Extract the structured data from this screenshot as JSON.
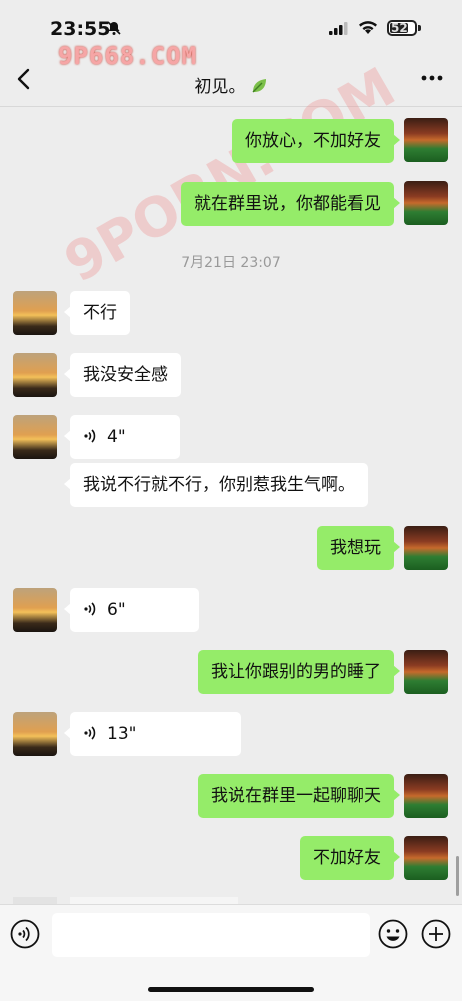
{
  "status_bar": {
    "time": "23:55",
    "battery": "52"
  },
  "watermark": {
    "site": "9P668.COM",
    "diagonal": "9PORN.COM"
  },
  "header": {
    "title": "初见。"
  },
  "timestamp": "7月21日 23:07",
  "messages": [
    {
      "from": "me",
      "text": "你放心，不加好友"
    },
    {
      "from": "me",
      "text": "就在群里说，你都能看见"
    },
    {
      "from": "her",
      "text": "不行"
    },
    {
      "from": "her",
      "text": "我没安全感"
    },
    {
      "from": "her",
      "type": "voice",
      "text": "4\""
    },
    {
      "from": "her",
      "text": "我说不行就不行，你别惹我生气啊。"
    },
    {
      "from": "me",
      "text": "我想玩"
    },
    {
      "from": "her",
      "type": "voice",
      "text": "6\""
    },
    {
      "from": "me",
      "text": "我让你跟别的男的睡了"
    },
    {
      "from": "her",
      "type": "voice",
      "text": "13\""
    },
    {
      "from": "me",
      "text": "我说在群里一起聊聊天"
    },
    {
      "from": "me",
      "text": "不加好友"
    }
  ],
  "colors": {
    "me_bubble": "#95ec69",
    "her_bubble": "#ffffff",
    "background": "#ededed"
  },
  "icons": [
    "bell-mute-icon",
    "signal-icon",
    "wifi-icon",
    "battery-icon",
    "back-icon",
    "leaf-icon",
    "more-icon",
    "voice-icon",
    "emoji-icon",
    "plus-icon"
  ]
}
